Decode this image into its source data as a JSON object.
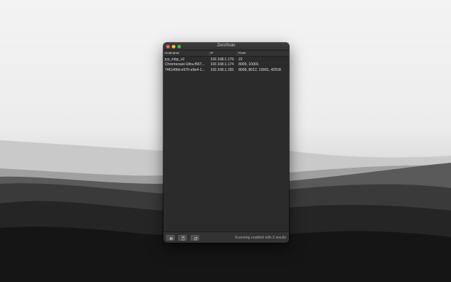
{
  "window": {
    "title": "ZeroScan"
  },
  "table": {
    "columns": [
      "Hostname",
      "IP",
      "Ports"
    ],
    "rows": [
      {
        "hostname": "jcp_mbp_v2",
        "ip": "192.168.1.179",
        "ports": "22"
      },
      {
        "hostname": "Chromecast-Ultra-f657...",
        "ip": "192.168.1.174",
        "ports": "8009, 10001"
      },
      {
        "hostname": "746149fd-e970-e9e4-1...",
        "ip": "192.168.1.155",
        "ports": "8009, 8012, 10001, 42918"
      }
    ]
  },
  "toolbar": {
    "pause_icon": "pause-icon",
    "trash_icon": "trash-icon",
    "refresh_icon": "refresh-icon"
  },
  "status": {
    "text": "Scanning enabled with 3 results"
  },
  "colors": {
    "window_bg": "#2b2b2b",
    "close": "#fe5f57",
    "minimize": "#febc2e",
    "zoom": "#28c840"
  }
}
